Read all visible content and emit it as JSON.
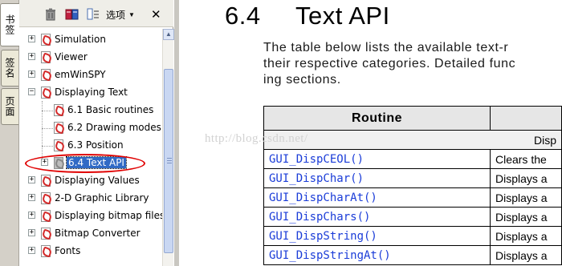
{
  "side_tabs": [
    {
      "label": "书签",
      "active": true
    },
    {
      "label": "签名",
      "active": false
    },
    {
      "label": "页面",
      "active": false
    }
  ],
  "toolbar": {
    "delete_icon": "trash-icon",
    "bookmark_icon": "new-bookmark-icon",
    "expand_icon": "expand-bookmark-icon",
    "options_label": "选项",
    "close_label": "✕"
  },
  "tree": [
    {
      "label": "Simulation",
      "expander": "+",
      "level": 0
    },
    {
      "label": "Viewer",
      "expander": "+",
      "level": 0
    },
    {
      "label": "emWinSPY",
      "expander": "+",
      "level": 0
    },
    {
      "label": "Displaying Text",
      "expander": "−",
      "level": 0
    },
    {
      "label": "6.1 Basic routines",
      "expander": "",
      "level": 1
    },
    {
      "label": "6.2 Drawing modes",
      "expander": "",
      "level": 1
    },
    {
      "label": "6.3 Position",
      "expander": "",
      "level": 1
    },
    {
      "label": "6.4 Text API",
      "expander": "+",
      "level": 1,
      "selected": true
    },
    {
      "label": "Displaying Values",
      "expander": "+",
      "level": 0
    },
    {
      "label": "2-D Graphic Library",
      "expander": "+",
      "level": 0
    },
    {
      "label": "Displaying bitmap files",
      "expander": "+",
      "level": 0
    },
    {
      "label": "Bitmap Converter",
      "expander": "+",
      "level": 0
    },
    {
      "label": "Fonts",
      "expander": "+",
      "level": 0
    }
  ],
  "document": {
    "section_number": "6.4",
    "section_title": "Text API",
    "para_line1": "The table below lists the available text-r",
    "para_line2": "their respective categories. Detailed func",
    "para_line3": "ing sections.",
    "table": {
      "header_routine": "Routine",
      "category": "Disp",
      "rows": [
        {
          "routine": "GUI_DispCEOL()",
          "desc": "Clears the"
        },
        {
          "routine": "GUI_DispChar()",
          "desc": "Displays a"
        },
        {
          "routine": "GUI_DispCharAt()",
          "desc": "Displays a"
        },
        {
          "routine": "GUI_DispChars()",
          "desc": "Displays a"
        },
        {
          "routine": "GUI_DispString()",
          "desc": "Displays a"
        },
        {
          "routine": "GUI_DispStringAt()",
          "desc": "Displays a"
        }
      ]
    }
  },
  "watermark": "http://blog.csdn.net/",
  "colors": {
    "link": "#1a3cd8",
    "selection": "#316ac5",
    "annotation": "#e00000"
  }
}
